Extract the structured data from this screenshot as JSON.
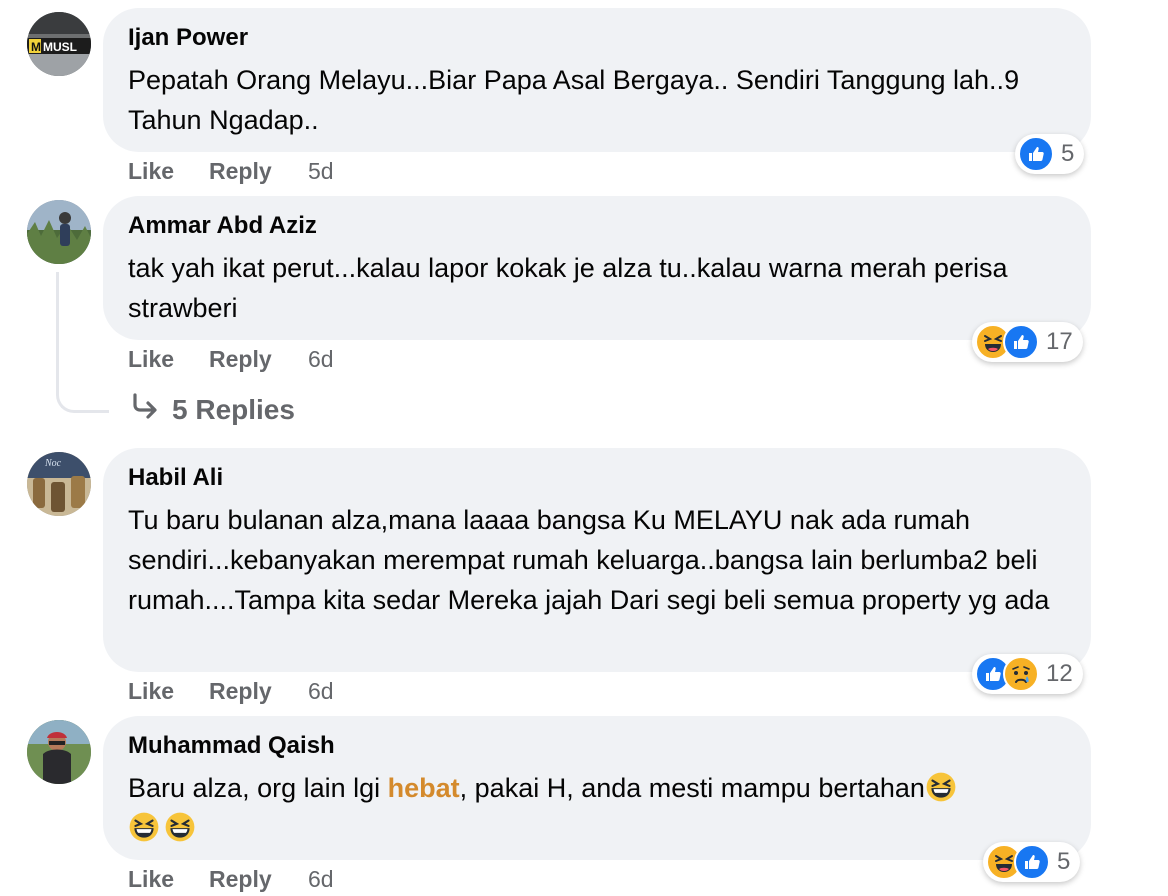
{
  "comments": [
    {
      "author": "Ijan Power",
      "text": "Pepatah Orang Melayu...Biar Papa Asal Bergaya.. Sendiri Tanggung lah..9 Tahun Ngadap..",
      "like_label": "Like",
      "reply_label": "Reply",
      "time": "5d",
      "reactions": [
        "like-icon"
      ],
      "reaction_count": "5",
      "avatar_text": "MUSL"
    },
    {
      "author": "Ammar Abd Aziz",
      "text": "tak yah ikat perut...kalau lapor kokak je alza tu..kalau warna merah perisa strawberi",
      "like_label": "Like",
      "reply_label": "Reply",
      "time": "6d",
      "reactions": [
        "haha-icon",
        "like-icon"
      ],
      "reaction_count": "17",
      "replies_label": "5 Replies"
    },
    {
      "author": "Habil Ali",
      "text": "Tu baru bulanan alza,mana laaaa bangsa Ku MELAYU nak ada rumah sendiri...kebanyakan merempat rumah keluarga..bangsa lain berlumba2 beli rumah....Tampa kita sedar Mereka jajah Dari segi beli semua property yg ada",
      "like_label": "Like",
      "reply_label": "Reply",
      "time": "6d",
      "reactions": [
        "like-icon",
        "sad-icon"
      ],
      "reaction_count": "12"
    },
    {
      "author": "Muhammad Qaish",
      "text_before": "Baru alza, org lain lgi ",
      "text_highlight": "hebat",
      "text_after": ", pakai H, anda mesti mampu bertahan",
      "like_label": "Like",
      "reply_label": "Reply",
      "time": "6d",
      "reactions": [
        "haha-icon",
        "like-icon"
      ],
      "reaction_count": "5"
    }
  ],
  "colors": {
    "bubble": "#f0f2f5",
    "meta_text": "#65676b",
    "like_blue": "#1877f2",
    "highlight": "#d48a2c",
    "emoji_yellow": "#f7b125"
  }
}
